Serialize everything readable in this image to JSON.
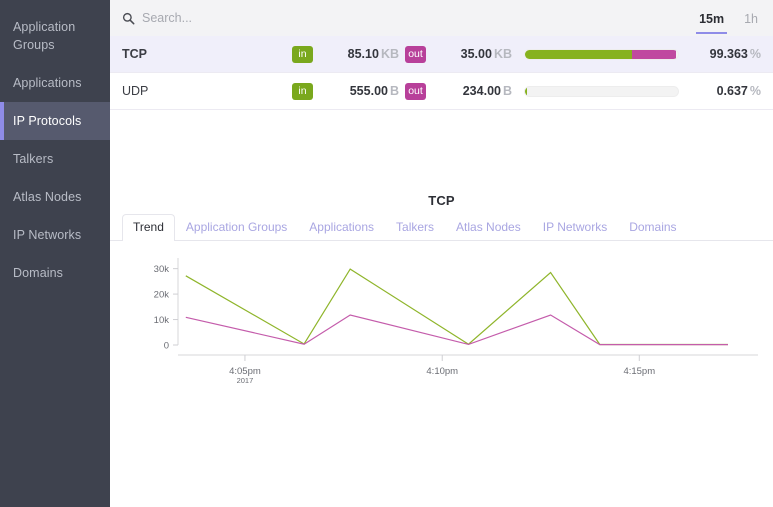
{
  "sidebar": {
    "items": [
      {
        "label": "Application Groups",
        "active": false
      },
      {
        "label": "Applications",
        "active": false
      },
      {
        "label": "IP Protocols",
        "active": true
      },
      {
        "label": "Talkers",
        "active": false
      },
      {
        "label": "Atlas Nodes",
        "active": false
      },
      {
        "label": "IP Networks",
        "active": false
      },
      {
        "label": "Domains",
        "active": false
      }
    ]
  },
  "search": {
    "placeholder": "Search...",
    "value": "",
    "icon": "search-icon"
  },
  "time_range": {
    "options": [
      {
        "label": "15m",
        "active": true
      },
      {
        "label": "1h",
        "active": false
      }
    ]
  },
  "protocol_list": {
    "rows": [
      {
        "name": "TCP",
        "selected": true,
        "in_badge": "in",
        "in_value": "85.10",
        "in_unit": "KB",
        "out_badge": "out",
        "out_value": "35.00",
        "out_unit": "KB",
        "bar_in_pct": 70,
        "bar_out_pct": 29,
        "percent": "99.363",
        "percent_unit": "%"
      },
      {
        "name": "UDP",
        "selected": false,
        "in_badge": "in",
        "in_value": "555.00",
        "in_unit": "B",
        "out_badge": "out",
        "out_value": "234.00",
        "out_unit": "B",
        "bar_in_pct": 1,
        "bar_out_pct": 0,
        "percent": "0.637",
        "percent_unit": "%"
      }
    ]
  },
  "detail": {
    "title": "TCP",
    "tabs": [
      {
        "label": "Trend",
        "active": true
      },
      {
        "label": "Application Groups",
        "active": false
      },
      {
        "label": "Applications",
        "active": false
      },
      {
        "label": "Talkers",
        "active": false
      },
      {
        "label": "Atlas Nodes",
        "active": false
      },
      {
        "label": "IP Networks",
        "active": false
      },
      {
        "label": "Domains",
        "active": false
      }
    ]
  },
  "colors": {
    "accent": "#8f8ce8",
    "in_green": "#86b21e",
    "out_magenta": "#c0499f",
    "sidebar_bg": "#3e424e",
    "sidebar_active_bg": "#565a6e",
    "row_selected_bg": "#f0effa",
    "search_bg": "#f3f3f5"
  },
  "chart_data": {
    "type": "line",
    "title": "TCP",
    "xlabel": "",
    "ylabel": "",
    "ylim": [
      0,
      33000
    ],
    "yticks": [
      0,
      10000,
      20000,
      30000
    ],
    "ytick_labels": [
      "0",
      "10k",
      "20k",
      "30k"
    ],
    "grid": false,
    "legend": "none",
    "x_axis_sub_label": "2017",
    "xticks": [
      {
        "value": 4.0833,
        "label": "4:05pm",
        "sub": "2017"
      },
      {
        "value": 4.1667,
        "label": "4:10pm",
        "sub": ""
      },
      {
        "value": 4.25,
        "label": "4:15pm",
        "sub": ""
      }
    ],
    "xlim": [
      4.055,
      4.2875
    ],
    "series": [
      {
        "name": "in",
        "color": "#8fb52b",
        "x": [
          4.0583,
          4.1083,
          4.1278,
          4.1778,
          4.2125,
          4.2333,
          4.2875
        ],
        "values": [
          27200,
          400,
          29800,
          300,
          28500,
          200,
          200
        ]
      },
      {
        "name": "out",
        "color": "#c45cab",
        "x": [
          4.0583,
          4.1083,
          4.1278,
          4.1778,
          4.2125,
          4.2333,
          4.2875
        ],
        "values": [
          10900,
          300,
          11800,
          250,
          11800,
          150,
          150
        ]
      }
    ]
  }
}
